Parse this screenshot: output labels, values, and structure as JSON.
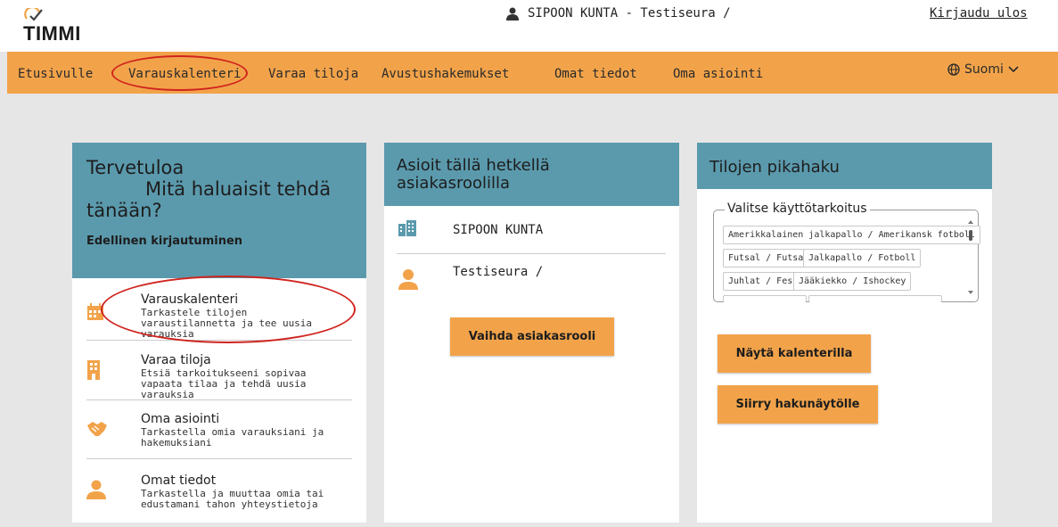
{
  "header": {
    "logo_text": "TIMMI",
    "user_info": "SIPOON KUNTA - Testiseura /",
    "logout_label": "Kirjaudu ulos"
  },
  "nav": {
    "items": [
      "Etusivulle",
      "Varauskalenteri",
      "Varaa tiloja",
      "Avustushakemukset",
      "Omat tiedot",
      "Oma asiointi"
    ],
    "language": "Suomi"
  },
  "welcome": {
    "line1": "Tervetuloa",
    "line2": "Mitä haluaisit tehdä",
    "line3": "tänään?",
    "last_login": "Edellinen kirjautuminen",
    "menu": [
      {
        "title": "Varauskalenteri",
        "desc": "Tarkastele tilojen varaustilannetta ja tee uusia varauksia",
        "icon": "calendar-icon"
      },
      {
        "title": "Varaa tiloja",
        "desc": "Etsiä tarkoitukseeni sopivaa vapaata tilaa ja tehdä uusia varauksia",
        "icon": "building-icon"
      },
      {
        "title": "Oma asiointi",
        "desc": "Tarkastella omia varauksiani ja hakemuksiani",
        "icon": "handshake-icon"
      },
      {
        "title": "Omat tiedot",
        "desc": "Tarkastella ja muuttaa omia tai edustamani tahon yhteystietoja",
        "icon": "person-icon"
      }
    ]
  },
  "roles": {
    "title": "Asioit tällä hetkellä asiakasroolilla",
    "org": "SIPOON KUNTA",
    "person": "Testiseura /",
    "switch_button": "Vaihda asiakasrooli"
  },
  "quicksearch": {
    "title": "Tilojen pikahaku",
    "legend": "Valitse käyttötarkoitus",
    "chips": [
      "Amerikkalainen jalkapallo / Amerikansk fotboll",
      "Futsal / Futsal",
      "Jalkapallo / Fotboll",
      "Juhlat / Fest",
      "Jääkiekko / Ishockey"
    ],
    "show_calendar_button": "Näytä kalenterilla",
    "search_view_button": "Siirry hakunäytölle"
  },
  "colors": {
    "accent": "#f2a34a",
    "header": "#5b9aad",
    "highlight": "#d0241e"
  }
}
